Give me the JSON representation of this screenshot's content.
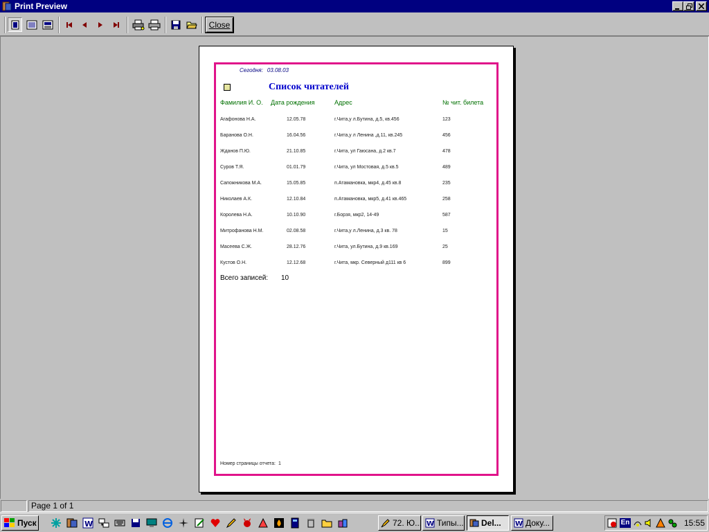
{
  "window": {
    "title": "Print Preview"
  },
  "toolbar": {
    "close_label": "Close"
  },
  "report": {
    "today_label": "Сегодня:",
    "today_value": "03.08.03",
    "title": "Список читателей",
    "headers": [
      "Фамилия И. О.",
      "Дата рождения",
      "Адрес",
      "№ чит. билета"
    ],
    "rows": [
      [
        "Агафонова Н.А.",
        "12.05.78",
        "г.Чита,у л.Бутина, д.5, кв.456",
        "123"
      ],
      [
        "Баранова  О.Н.",
        "16.04.56",
        "г.Чита,у л Ленина ,д.11, кв.245",
        "456"
      ],
      [
        "Жданов П.Ю.",
        "21.10.85",
        "г.Чита, ул Гаюсана,  д.2  кв.7",
        "478"
      ],
      [
        "Суров Т.Я.",
        "01.01.79",
        "г.Чита, ул Мостовая, д.5  кв.5",
        "489"
      ],
      [
        "Сапожникова М.А.",
        "15.05.85",
        "п.Атамановка, мкр4,  д.45 кв.8",
        "235"
      ],
      [
        "Николаев А.К.",
        "12.10.84",
        "п.Атамановка, мкр5, д.41 кв.465",
        "258"
      ],
      [
        "Королева Н.А.",
        "10.10.90",
        "г.Борзя, мкр2, 14-49",
        "587"
      ],
      [
        "Митрофанова Н.М.",
        "02.08.58",
        "г.Чита,у л.Ленина,  д.3 кв. 78",
        "15"
      ],
      [
        "Масеева С.Ж.",
        "28.12.76",
        "г.Чита, ул.Бутина, д.9 кв.169",
        "25"
      ],
      [
        "Кустов О.Н.",
        "12.12.68",
        "г.Чита, мкр. Северный д111 кв 6",
        "899"
      ]
    ],
    "total_label": "Всего записей:",
    "total_value": "10",
    "page_footer_label": "Номер страницы отчета:",
    "page_footer_value": "1"
  },
  "statusbar": {
    "page_info": "Page 1 of 1"
  },
  "taskbar": {
    "start_label": "Пуск",
    "tasks": [
      "72. Ю...",
      "Типы...",
      "Del...",
      "Доку..."
    ],
    "clock": "15:55",
    "lang": "En"
  },
  "colors": {
    "titlebar": "#000080",
    "frame": "#e0138a",
    "report_title": "#0000cc",
    "headers": "#007000"
  }
}
